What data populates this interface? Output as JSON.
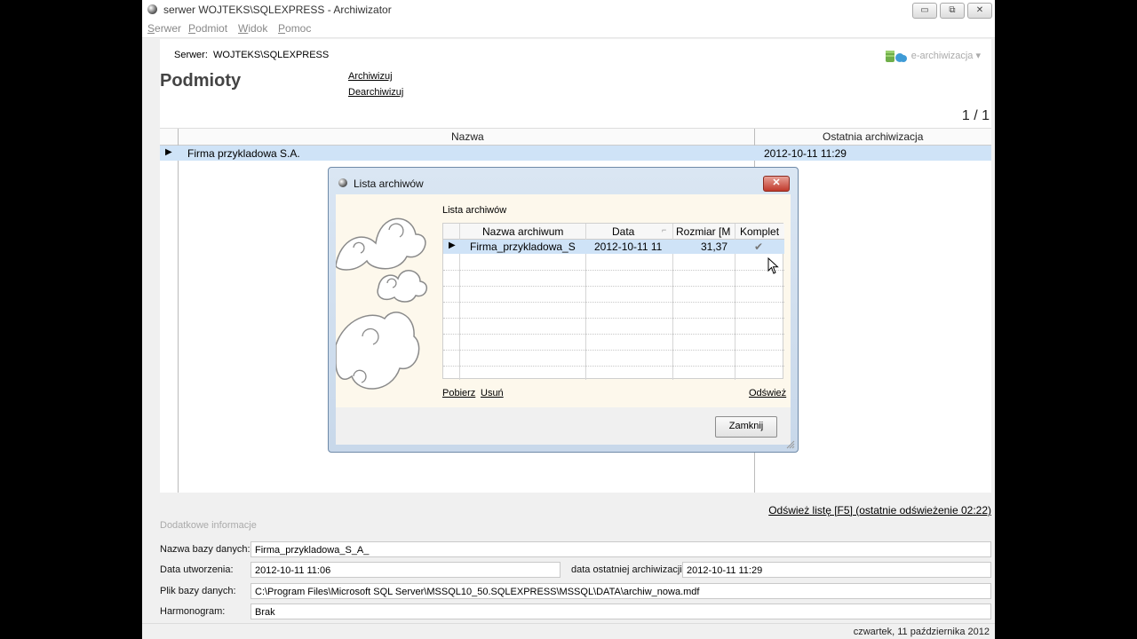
{
  "window": {
    "title": "serwer WOJTEKS\\SQLEXPRESS - Archiwizator",
    "minimize_glyph": "▭",
    "maximize_glyph": "⧉",
    "close_glyph": "✕"
  },
  "menu": [
    "Serwer",
    "Podmiot",
    "Widok",
    "Pomoc"
  ],
  "header": {
    "server_label": "Serwer:",
    "server_value": "WOJTEKS\\SQLEXPRESS",
    "e_archive": "e-archiwizacja",
    "e_archive_arrow": "▾"
  },
  "panel": {
    "title": "Podmioty",
    "archive_link": "Archiwizuj",
    "dearchive_link": "Dearchiwizuj",
    "pager": "1 / 1"
  },
  "grid": {
    "columns": [
      "Nazwa",
      "Ostatnia archiwizacja"
    ],
    "row_marker": "▶",
    "rows": [
      {
        "name": "Firma przykladowa S.A.",
        "last": "2012-10-11 11:29"
      }
    ]
  },
  "refresh_link": "Odśwież listę [F5] (ostatnie odświeżenie 02:22)",
  "details": {
    "section": "Dodatkowe informacje",
    "db_name_label": "Nazwa bazy danych:",
    "db_name": "Firma_przykladowa_S_A_",
    "created_label": "Data utworzenia:",
    "created": "2012-10-11 11:06",
    "last_archive_label": "data ostatniej archiwizacji:",
    "last_archive": "2012-10-11 11:29",
    "file_label": "Plik bazy danych:",
    "file": "C:\\Program Files\\Microsoft SQL Server\\MSSQL10_50.SQLEXPRESS\\MSSQL\\DATA\\archiw_nowa.mdf",
    "schedule_label": "Harmonogram:",
    "schedule": "Brak"
  },
  "status": "czwartek, 11 października 2012",
  "dialog": {
    "title": "Lista archiwów",
    "close_glyph": "✕",
    "group_label": "Lista archiwów",
    "columns": [
      "Nazwa archiwum",
      "Data",
      "Rozmiar [M",
      "Komplet"
    ],
    "sort_glyph": "⌐",
    "row_marker": "▶",
    "rows": [
      {
        "name": "Firma_przykladowa_S",
        "date": "2012-10-11 11",
        "size": "31,37",
        "complete": "✔"
      }
    ],
    "download": "Pobierz",
    "delete": "Usuń",
    "refresh": "Odśwież",
    "close_button": "Zamknij"
  }
}
